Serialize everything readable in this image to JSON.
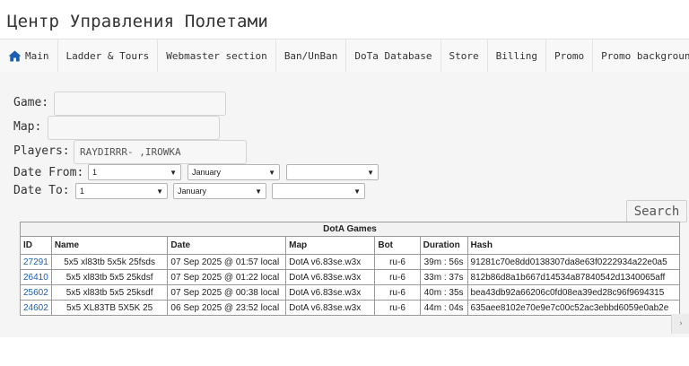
{
  "site": {
    "title": "Центр Управления Полетами"
  },
  "nav": {
    "items": [
      {
        "label": "Main",
        "icon": "home-icon"
      },
      {
        "label": "Ladder & Tours"
      },
      {
        "label": "Webmaster section"
      },
      {
        "label": "Ban/UnBan"
      },
      {
        "label": "DoTa Database"
      },
      {
        "label": "Store"
      },
      {
        "label": "Billing"
      },
      {
        "label": "Promo"
      },
      {
        "label": "Promo background"
      }
    ]
  },
  "form": {
    "game_label": "Game:",
    "game_value": "",
    "map_label": "Map:",
    "map_value": "",
    "players_label": "Players:",
    "players_value": "RAYDIRRR- ,IROWKA",
    "date_from_label": "Date From:",
    "date_from_day": "1",
    "date_from_month": "January",
    "date_from_year": "",
    "date_to_label": "Date To:",
    "date_to_day": "1",
    "date_to_month": "January",
    "date_to_year": "",
    "search_label": "Search"
  },
  "table": {
    "caption": "DotA Games",
    "headers": [
      "ID",
      "Name",
      "Date",
      "Map",
      "Bot",
      "Duration",
      "Hash"
    ],
    "rows": [
      {
        "id": "27291",
        "name": "5x5 xl83tb 5x5k 25fsds",
        "date": "07 Sep 2025 @ 01:57 local",
        "map": "DotA v6.83se.w3x",
        "bot": "ru-6",
        "duration": "39m : 56s",
        "hash": "91281c70e8dd0138307da8e63f0222934a22e0a5"
      },
      {
        "id": "26410",
        "name": "5x5 xl83tb 5x5 25kdsf",
        "date": "07 Sep 2025 @ 01:22 local",
        "map": "DotA v6.83se.w3x",
        "bot": "ru-6",
        "duration": "33m : 37s",
        "hash": "812b86d8a1b667d14534a87840542d1340065aff"
      },
      {
        "id": "25602",
        "name": "5x5 xl83tb 5x5 25ksdf",
        "date": "07 Sep 2025 @ 00:38 local",
        "map": "DotA v6.83se.w3x",
        "bot": "ru-6",
        "duration": "40m : 35s",
        "hash": "bea43db92a66206c0fd08ea39ed28c96f9694315"
      },
      {
        "id": "24602",
        "name": "5x5 XL83TB 5X5K 25",
        "date": "06 Sep 2025 @ 23:52 local",
        "map": "DotA v6.83se.w3x",
        "bot": "ru-6",
        "duration": "44m : 04s",
        "hash": "635aee8102e70e9e7c00c52ac3ebbd6059e0ab2e"
      }
    ]
  },
  "colors": {
    "link": "#1a5fb4",
    "navbar_bg": "#f8f8f8",
    "content_bg": "#f5f5f5"
  }
}
